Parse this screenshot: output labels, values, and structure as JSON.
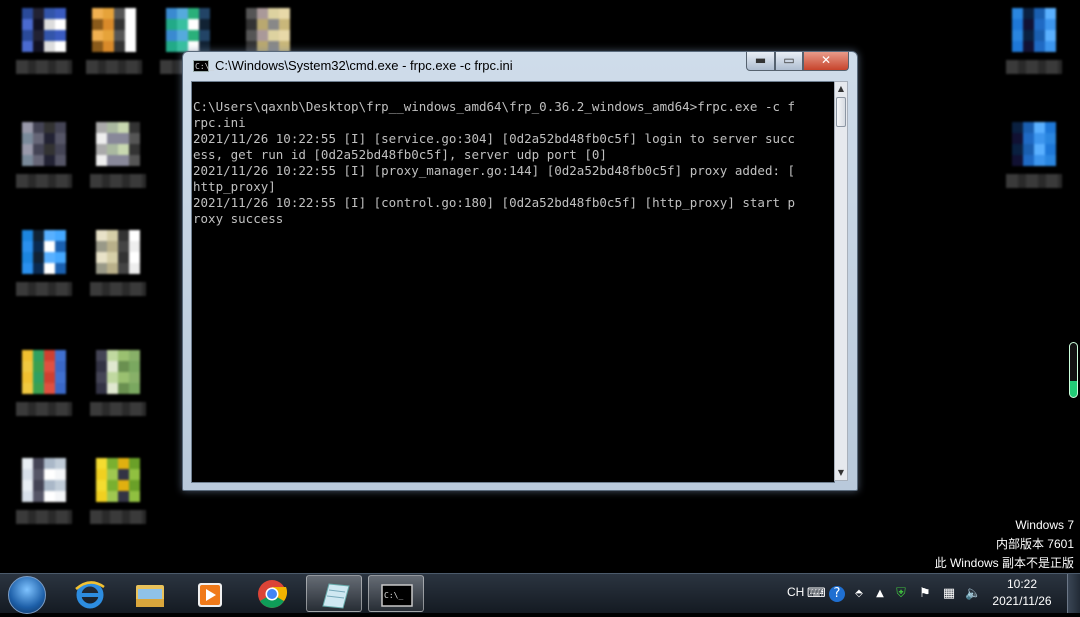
{
  "window": {
    "title": "C:\\Windows\\System32\\cmd.exe - frpc.exe  -c frpc.ini",
    "icon": "cmd-icon",
    "minimize_label": "▬",
    "maximize_label": "▭",
    "close_label": "✕"
  },
  "console": {
    "lines": [
      "C:\\Users\\qaxnb\\Desktop\\frp__windows_amd64\\frp_0.36.2_windows_amd64>frpc.exe -c f",
      "rpc.ini",
      "2021/11/26 10:22:55 [I] [service.go:304] [0d2a52bd48fb0c5f] login to server succ",
      "ess, get run id [0d2a52bd48fb0c5f], server udp port [0]",
      "2021/11/26 10:22:55 [I] [proxy_manager.go:144] [0d2a52bd48fb0c5f] proxy added: [",
      "http_proxy]",
      "2021/11/26 10:22:55 [I] [control.go:180] [0d2a52bd48fb0c5f] [http_proxy] start p",
      "roxy success"
    ],
    "text_color": "#c0c0c0",
    "background": "#000000"
  },
  "watermark": {
    "line1": "Windows 7",
    "line2": "内部版本 7601",
    "line3": "此 Windows 副本不是正版"
  },
  "taskbar": {
    "pinned": [
      {
        "name": "ie-icon"
      },
      {
        "name": "file-explorer-icon"
      },
      {
        "name": "media-player-icon"
      },
      {
        "name": "chrome-icon"
      },
      {
        "name": "notepad-icon"
      },
      {
        "name": "cmd-icon",
        "active": true
      }
    ],
    "tray": {
      "language": "CH",
      "time": "10:22",
      "date": "2021/11/26"
    }
  },
  "colors": {
    "desktop": "#000000",
    "taskbar": "#1e2631",
    "close_button": "#c7442c"
  }
}
